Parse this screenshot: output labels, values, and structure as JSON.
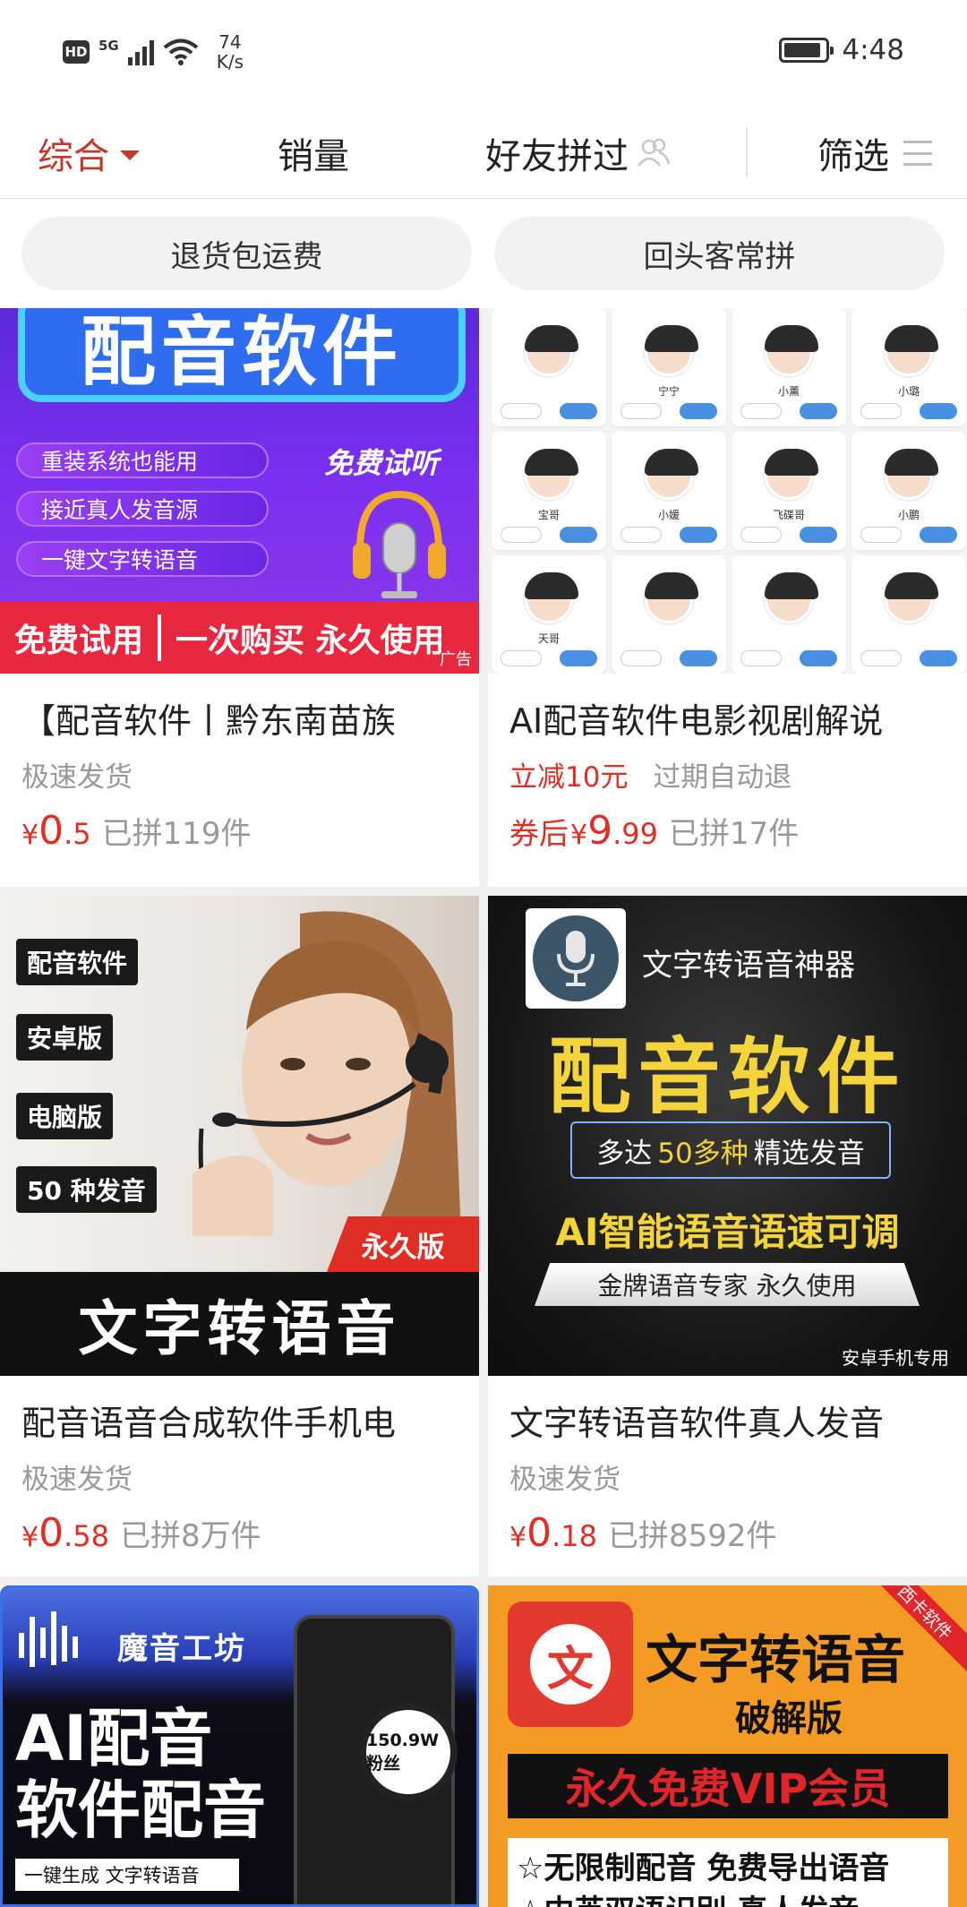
{
  "status_bar": {
    "hd": "HD",
    "network": "5G",
    "speed_value": "74",
    "speed_unit": "K/s",
    "time": "4:48",
    "battery_level": 0.9
  },
  "sort_bar": {
    "tabs": [
      {
        "label": "综合",
        "active": true
      },
      {
        "label": "销量",
        "active": false
      },
      {
        "label": "好友拼过",
        "active": false,
        "icon": "friends-icon"
      },
      {
        "label": "筛选",
        "active": false,
        "icon": "menu-icon"
      }
    ]
  },
  "chips": [
    "退货包运费",
    "回头客常拼"
  ],
  "products": [
    {
      "title": "【配音软件丨黔东南苗族",
      "tags": [
        {
          "text": "极速发货",
          "style": "gray"
        }
      ],
      "price_prefix": "",
      "price_int": "0",
      "price_dec": ".5",
      "sold": "已拼119件",
      "ad": "广告",
      "image_text": {
        "banner": "配音软件",
        "pills": [
          "重装系统也能用",
          "接近真人发音源",
          "一键文字转语音"
        ],
        "trial": "免费试听",
        "strip_left": "免费试用",
        "strip_right": "一次购买 永久使用"
      }
    },
    {
      "title": "AI配音软件电影视剧解说",
      "tags": [
        {
          "text": "立减10元",
          "style": "red"
        },
        {
          "text": "过期自动退",
          "style": "gray"
        }
      ],
      "price_prefix": "券后",
      "price_int": "9",
      "price_dec": ".99",
      "sold": "已拼17件",
      "image_text": {
        "voices": [
          "",
          "宁宁",
          "小薰",
          "小璐",
          "宝哥",
          "小媛",
          "飞碟哥",
          "小鹏",
          "天哥",
          "",
          "",
          ""
        ]
      }
    },
    {
      "title": "配音语音合成软件手机电",
      "tags": [
        {
          "text": "极速发货",
          "style": "gray"
        }
      ],
      "price_prefix": "",
      "price_int": "0",
      "price_dec": ".58",
      "sold": "已拼8万件",
      "image_text": {
        "tags": [
          "配音软件",
          "安卓版",
          "电脑版",
          "50 种发音"
        ],
        "permanent": "永久版",
        "bottom": "文字转语音"
      }
    },
    {
      "title": "文字转语音软件真人发音",
      "tags": [
        {
          "text": "极速发货",
          "style": "gray"
        }
      ],
      "price_prefix": "",
      "price_int": "0",
      "price_dec": ".18",
      "sold": "已拼8592件",
      "image_text": {
        "sub": "文字转语音神器",
        "big": "配音软件",
        "box_a": "多达",
        "box_b": "50多种",
        "box_c": "精选发音",
        "ai": "AI智能语音语速可调",
        "gold": "金牌语音专家 永久使用",
        "android": "安卓手机专用"
      }
    },
    {
      "image_text": {
        "brand": "魔音工坊",
        "title_1": "AI配音",
        "title_2": "软件配音",
        "lens": "150.9W粉丝",
        "pill": "一键生成 文字转语音"
      }
    },
    {
      "image_text": {
        "t1": "文字转语音",
        "t2": "破解版",
        "corner": "西卡软件",
        "icon_char": "文",
        "vip": "永久免费VIP会员",
        "line1": "☆无限制配音 免费导出语音",
        "line2": "☆中英双语识别 真人发音"
      }
    }
  ],
  "colors": {
    "accent_red": "#e02e24",
    "sort_active": "#c0392b",
    "muted_gray": "#999999",
    "chip_bg": "#f2f2f2"
  }
}
